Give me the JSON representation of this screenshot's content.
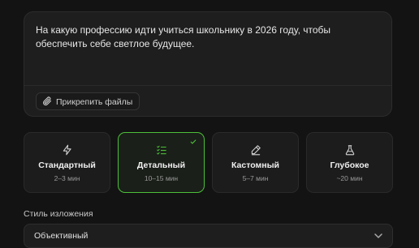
{
  "prompt": {
    "text": "На какую профессию идти учиться школьнику в 2026 году, чтобы обеспечить себе светлое будущее.",
    "attach_label": "Прикрепить файлы"
  },
  "modes": [
    {
      "title": "Стандартный",
      "time": "2–3 мин",
      "icon": "lightning-icon",
      "selected": false
    },
    {
      "title": "Детальный",
      "time": "10–15 мин",
      "icon": "checklist-icon",
      "selected": true
    },
    {
      "title": "Кастомный",
      "time": "5–7 мин",
      "icon": "pencil-icon",
      "selected": false
    },
    {
      "title": "Глубокое",
      "time": "~20 мин",
      "icon": "flask-icon",
      "selected": false
    }
  ],
  "style": {
    "label": "Стиль изложения",
    "selected": "Объективный"
  },
  "colors": {
    "accent": "#4cc038",
    "background": "#131313",
    "card": "#1e1e1e"
  }
}
